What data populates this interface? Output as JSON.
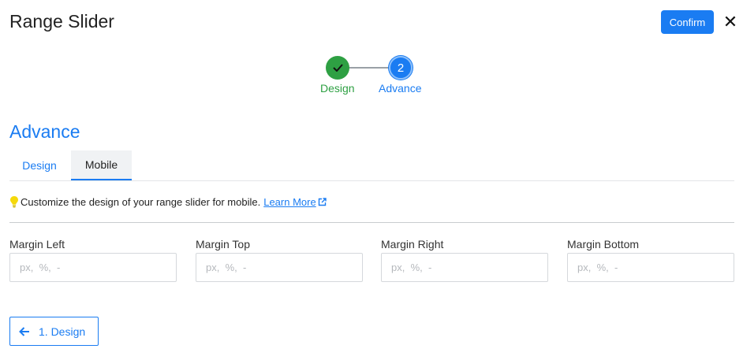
{
  "header": {
    "title": "Range Slider",
    "confirm_label": "Confirm",
    "close_glyph": "✕"
  },
  "stepper": {
    "steps": [
      {
        "label": "Design",
        "state": "done",
        "icon": "check-icon"
      },
      {
        "label": "Advance",
        "state": "active",
        "number": "2"
      }
    ]
  },
  "section": {
    "title": "Advance"
  },
  "tabs": [
    {
      "label": "Design",
      "selected": false
    },
    {
      "label": "Mobile",
      "selected": true
    }
  ],
  "hint": {
    "text": "Customize the design of your range slider for mobile.",
    "link_label": "Learn More"
  },
  "fields": [
    {
      "label": "Margin Left",
      "value": "",
      "placeholder": "px,  %,  -"
    },
    {
      "label": "Margin Top",
      "value": "",
      "placeholder": "px,  %,  -"
    },
    {
      "label": "Margin Right",
      "value": "",
      "placeholder": "px,  %,  -"
    },
    {
      "label": "Margin Bottom",
      "value": "",
      "placeholder": "px,  %,  -"
    }
  ],
  "footer": {
    "back_label": "1. Design"
  },
  "colors": {
    "accent": "#1a7cf2",
    "success": "#2ea043",
    "bulb": "#f5d90a"
  }
}
